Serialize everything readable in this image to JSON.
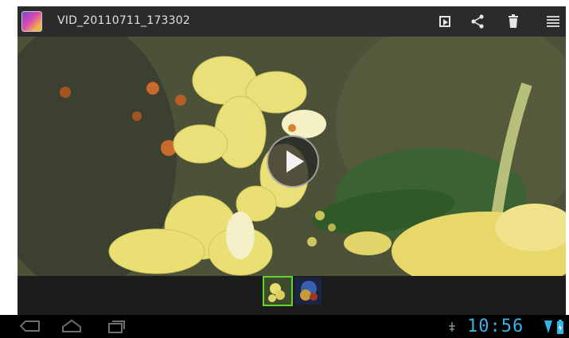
{
  "header": {
    "title": "VID_20110711_173302",
    "app_icon": "gallery-thumb-icon",
    "actions": [
      {
        "name": "slideshow",
        "icon": "play-square-icon"
      },
      {
        "name": "share",
        "icon": "share-icon"
      },
      {
        "name": "delete",
        "icon": "trash-icon"
      },
      {
        "name": "menu",
        "icon": "overflow-menu-icon"
      }
    ]
  },
  "media": {
    "type": "video",
    "play_button_icon": "play-circle-icon"
  },
  "filmstrip": {
    "items": [
      {
        "name": "video-thumbnail",
        "selected": true
      },
      {
        "name": "photo-thumbnail",
        "selected": false
      }
    ]
  },
  "system_bar": {
    "time": "10:56",
    "nav_icons": [
      "back-icon",
      "home-icon",
      "recent-apps-icon"
    ],
    "status_icons": [
      "usb-debug-icon",
      "wifi-signal-icon",
      "battery-icon"
    ],
    "accent_color": "#33b5e5"
  }
}
